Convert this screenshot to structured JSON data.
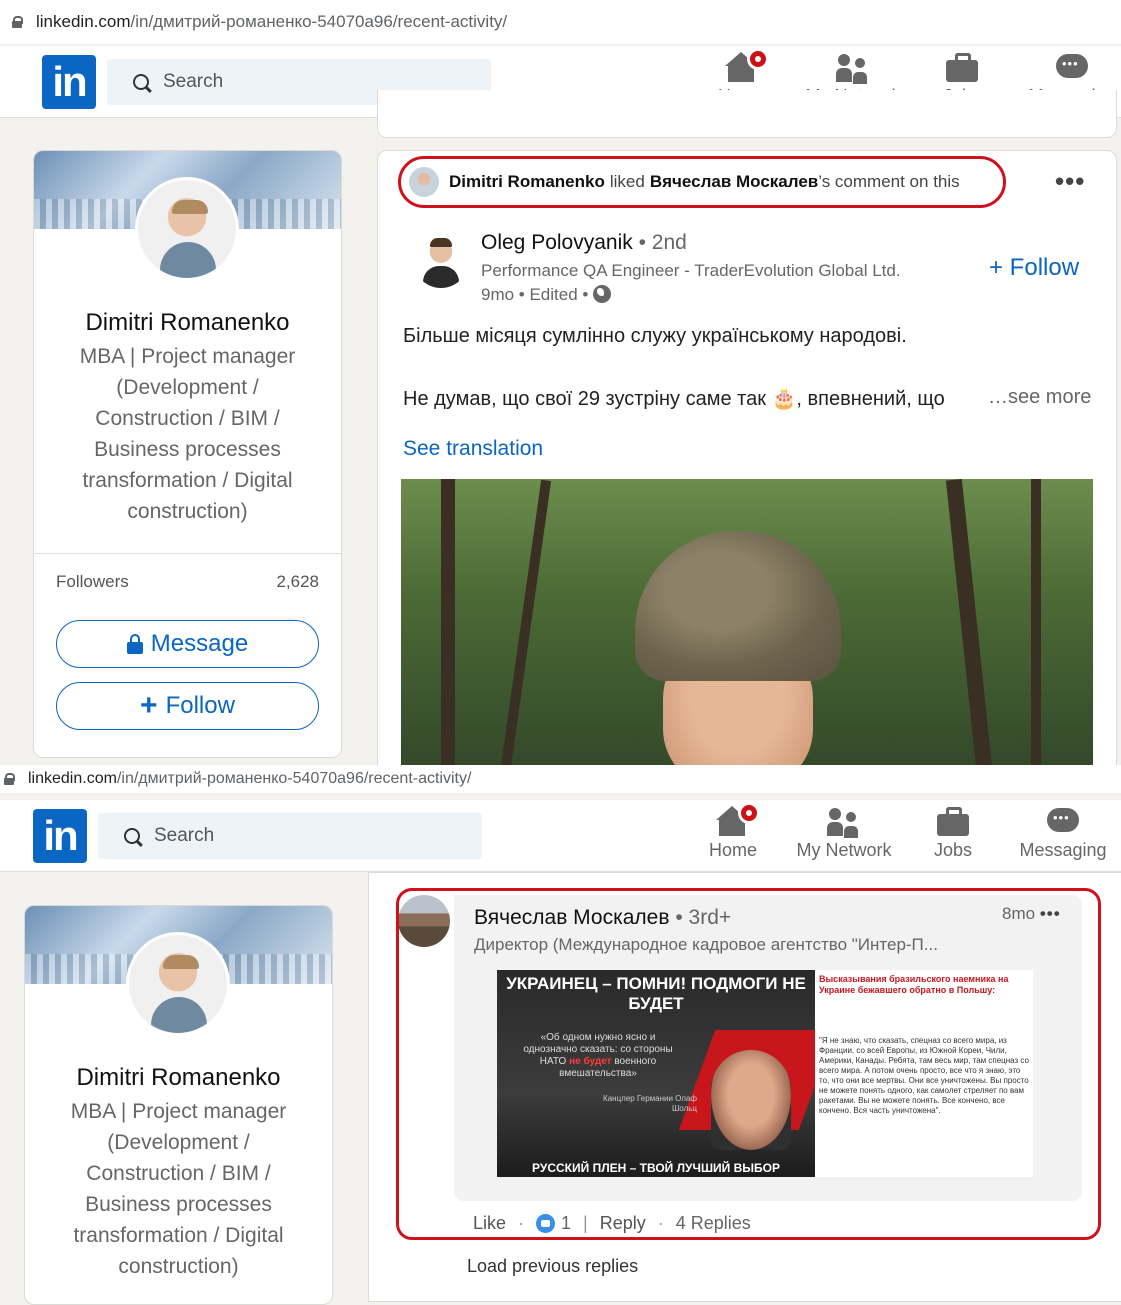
{
  "browser": {
    "url_domain": "linkedin.com",
    "url_path": "/in/дмитрий-романенко-54070a96/recent-activity/"
  },
  "nav": {
    "logo": "in",
    "search_placeholder": "Search",
    "items": [
      {
        "label": "Home",
        "icon": "home-icon",
        "notification": true
      },
      {
        "label": "My Network",
        "icon": "network-icon"
      },
      {
        "label": "Jobs",
        "icon": "briefcase-icon"
      },
      {
        "label": "Messaging",
        "icon": "messaging-icon"
      }
    ]
  },
  "profile": {
    "name": "Dimitri Romanenko",
    "headline": "MBA | Project manager (Development / Construction / BIM / Business processes transformation / Digital construction)",
    "followers_label": "Followers",
    "followers_count": "2,628",
    "message_label": "Message",
    "follow_label": "Follow"
  },
  "activity": {
    "actor": "Dimitri Romanenko",
    "verb": "liked",
    "target": "Вячеслав Москалев",
    "suffix": "’s comment on this",
    "more": "•••"
  },
  "post": {
    "author_name": "Oleg Polovyanik",
    "author_degree": "• 2nd",
    "author_headline": "Performance QA Engineer - TraderEvolution Global Ltd.",
    "meta": "9mo • Edited •",
    "follow_label": "+ Follow",
    "text_line1": "Більше місяця сумлінно служу українському народові.",
    "text_line2": "Не думав, що свої 29 зустріну саме так 🎂, впевнений, що",
    "see_more": "…see more",
    "see_translation": "See translation"
  },
  "comment": {
    "author_name": "Вячеслав Москалев",
    "author_degree": "• 3rd+",
    "author_headline": "Директор (Международное кадровое агентство \"Интер-П...",
    "time": "8mo",
    "more": "•••",
    "image": {
      "headline": "УКРАИНЕЦ – ПОМНИ! ПОДМОГИ НЕ БУДЕТ",
      "quote_part1": "«Об одном нужно ясно и однозначно сказать: со стороны НАТО",
      "quote_highlight": "не будет",
      "quote_part2": "военного вмешательства»",
      "caption": "Канцлер Германии Олаф Шольц",
      "footer": "РУССКИЙ ПЛЕН – ТВОЙ ЛУЧШИЙ ВЫБОР",
      "right_title": "Высказывания бразильского наемника на Украине бежавшего обратно в Польшу:",
      "right_text": "\"Я не знаю, что сказать, спецназ со всего мира, из Франции, со всей Европы, из Южной Кореи, Чили, Америки, Канады. Ребята, там весь мир, там спецназ со всего мира. А потом очень просто, все что я знаю, это то, что они все мертвы. Они все уничтожены. Вы просто не можете понять одного, как самолет стреляет по вам ракетами. Вы не можете понять. Все кончено, все кончено. Вся часть уничтожена\"."
    },
    "like_label": "Like",
    "like_count": "1",
    "reply_label": "Reply",
    "replies_label": "4 Replies",
    "load_previous": "Load previous replies"
  },
  "colors": {
    "brand": "#0a66c2",
    "highlight": "#d0101b",
    "background": "#f3f2ef"
  }
}
